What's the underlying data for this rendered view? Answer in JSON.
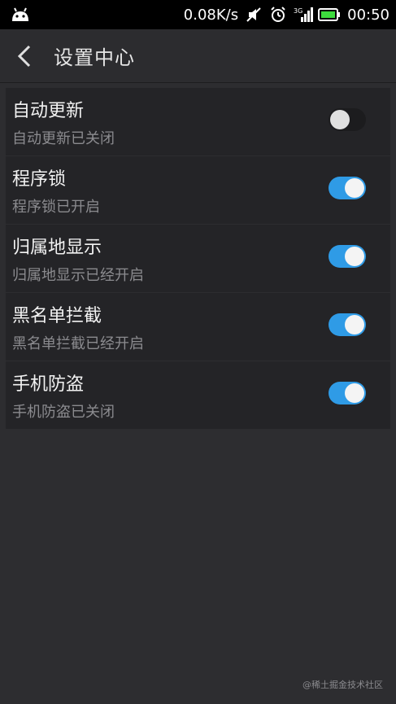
{
  "status_bar": {
    "speed": "0.08K/s",
    "network": "3G",
    "time": "00:50"
  },
  "header": {
    "title": "设置中心"
  },
  "settings": [
    {
      "title": "自动更新",
      "subtitle": "自动更新已关闭",
      "enabled": false
    },
    {
      "title": "程序锁",
      "subtitle": "程序锁已开启",
      "enabled": true
    },
    {
      "title": "归属地显示",
      "subtitle": "归属地显示已经开启",
      "enabled": true
    },
    {
      "title": "黑名单拦截",
      "subtitle": "黑名单拦截已经开启",
      "enabled": true
    },
    {
      "title": "手机防盗",
      "subtitle": "手机防盗已关闭",
      "enabled": true
    }
  ],
  "watermark": "@稀土掘金技术社区",
  "colors": {
    "accent": "#2f9be6",
    "background": "#2d2d30",
    "row_background": "#242427"
  }
}
